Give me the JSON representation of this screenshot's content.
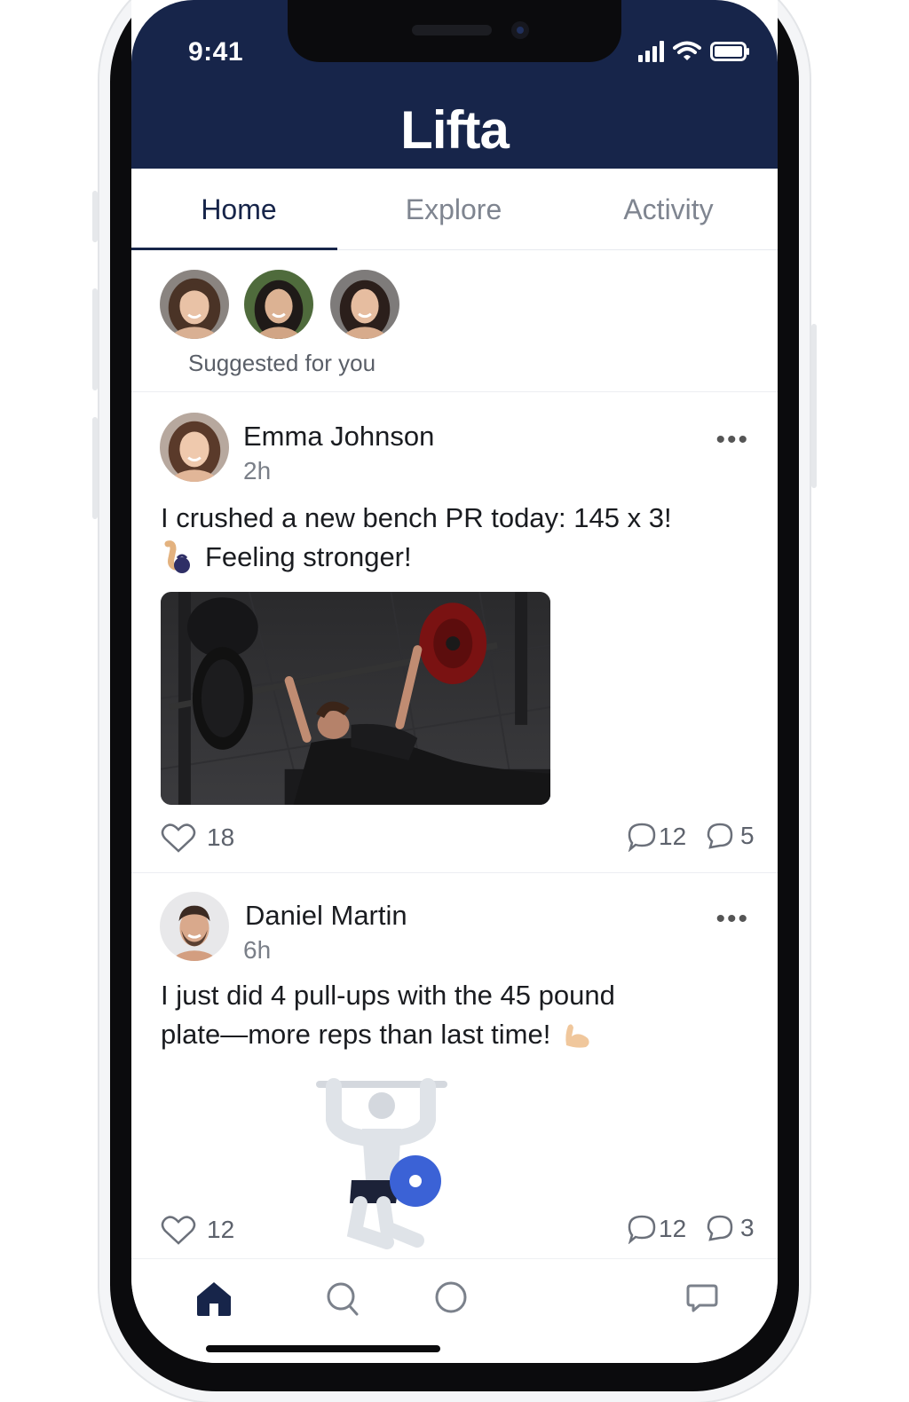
{
  "status_bar": {
    "time": "9:41"
  },
  "app": {
    "title": "Lifta",
    "brand_color": "#17254a"
  },
  "tabs": [
    {
      "label": "Home",
      "active": true
    },
    {
      "label": "Explore",
      "active": false
    },
    {
      "label": "Activity",
      "active": false
    }
  ],
  "suggested": {
    "label": "Suggested for you",
    "avatars": [
      "avatar-woman-1",
      "avatar-woman-2",
      "avatar-woman-3"
    ]
  },
  "posts": [
    {
      "author": "Emma Johnson",
      "time": "2h",
      "text_line1": "I crushed a new bench PR today: 145 x 3!",
      "text_line2": "Feeling stronger!",
      "emoji_icon": "flexed-arm-kettlebell-icon",
      "media": "bench-press-photo",
      "likes": "18",
      "comments": "12",
      "replies": "5"
    },
    {
      "author": "Daniel Martin",
      "time": "6h",
      "text_line1": "I just did 4 pull-ups with the 45 pound",
      "text_line2": "plate—more reps than last time!",
      "emoji_icon": "flexed-biceps-icon",
      "media": "weightlifter-illustration",
      "likes": "12",
      "comments": "12",
      "replies": "3"
    }
  ],
  "bottom_nav": [
    "home-icon",
    "search-icon",
    "circle-icon",
    "chat-icon"
  ]
}
